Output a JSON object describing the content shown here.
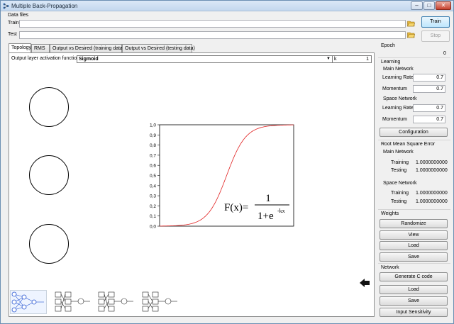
{
  "window": {
    "title": "Multiple Back-Propagation"
  },
  "data_files": {
    "section_label": "Data files",
    "train_label": "Train",
    "test_label": "Test",
    "train_value": "",
    "test_value": ""
  },
  "actions": {
    "train": "Train",
    "stop": "Stop"
  },
  "tabs": [
    {
      "label": "Topology",
      "active": true
    },
    {
      "label": "RMS"
    },
    {
      "label": "Output vs Desired (training data)"
    },
    {
      "label": "Output vs Desired (testing data)"
    }
  ],
  "topology": {
    "activation_label": "Output layer activation function",
    "activation_value": "Sigmoid",
    "k_label": "k",
    "k_value": "1",
    "y_ticks": [
      "1,0",
      "0,9",
      "0,8",
      "0,7",
      "0,6",
      "0,5",
      "0,4",
      "0,3",
      "0,2",
      "0,1",
      "0,0"
    ],
    "formula": {
      "lhs": "F(x)=",
      "numerator": "1",
      "denominator": "1+e",
      "exponent": "-kx"
    },
    "curve_color": "#e02020"
  },
  "epoch": {
    "label": "Epoch",
    "value": "0"
  },
  "learning": {
    "label": "Learning",
    "main": {
      "label": "Main Network",
      "learning_rate_label": "Learning Rate",
      "learning_rate": "0.7",
      "momentum_label": "Momentum",
      "momentum": "0.7"
    },
    "space": {
      "label": "Space Network",
      "learning_rate_label": "Learning Rate",
      "learning_rate": "0.7",
      "momentum_label": "Momentum",
      "momentum": "0.7"
    },
    "configuration": "Configuration"
  },
  "rms": {
    "label": "Root Mean Square Error",
    "main": {
      "label": "Main Network",
      "training_label": "Training",
      "training": "1.0000000000",
      "testing_label": "Testing",
      "testing": "1.0000000000"
    },
    "space": {
      "label": "Space Network",
      "training_label": "Training",
      "training": "1.0000000000",
      "testing_label": "Testing",
      "testing": "1.0000000000"
    }
  },
  "weights": {
    "label": "Weights",
    "randomize": "Randomize",
    "view": "View",
    "load": "Load",
    "save": "Save"
  },
  "network": {
    "label": "Network",
    "generate": "Generate C code",
    "load": "Load",
    "save": "Save",
    "sensitivity": "Input Sensitivity"
  }
}
